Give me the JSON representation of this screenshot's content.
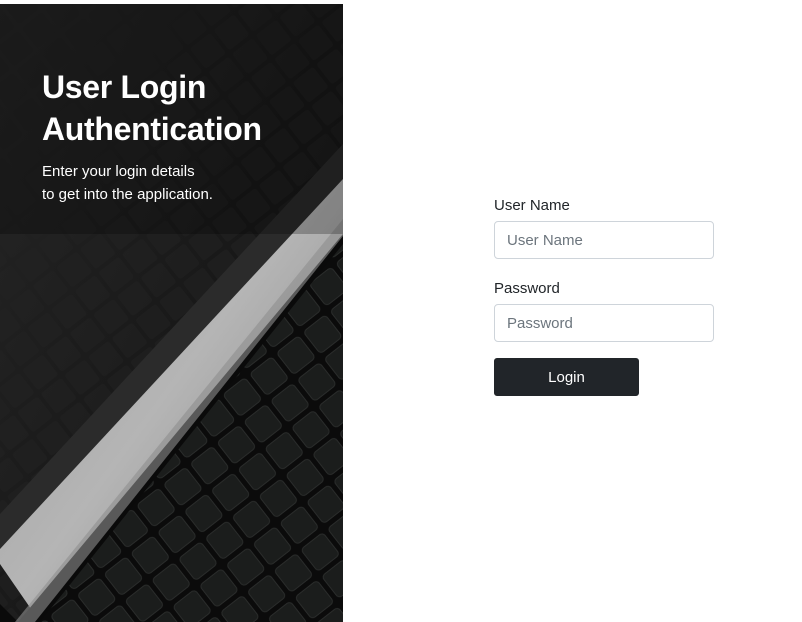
{
  "hero": {
    "title_line1": "User Login",
    "title_line2": "Authentication",
    "subtitle_line1": "Enter your login details",
    "subtitle_line2": "to get into the application.",
    "image": "laptop-keyboard-photo"
  },
  "form": {
    "username": {
      "label": "User Name",
      "placeholder": "User Name",
      "value": ""
    },
    "password": {
      "label": "Password",
      "placeholder": "Password",
      "value": ""
    },
    "login_label": "Login"
  },
  "colors": {
    "button_bg": "#212529",
    "button_text": "#ffffff",
    "input_border": "#ced4da",
    "hero_bg": "#1a1a1a"
  }
}
